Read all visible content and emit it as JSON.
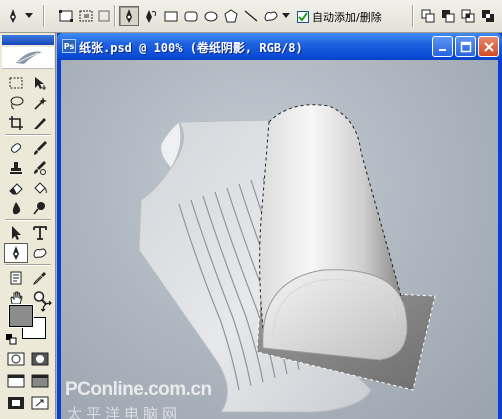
{
  "options_bar": {
    "auto_add_delete_label": "自动添加/删除",
    "auto_add_delete_checked": true
  },
  "toolbox": {
    "active_tool": "pen-tool",
    "foreground_color": "#8c8c8c",
    "background_color": "#ffffff"
  },
  "document": {
    "title": "纸张.psd @ 100% (卷纸阴影, RGB/8)"
  },
  "watermark": {
    "text": "PConline.com.cn",
    "cn_text": "太平洋电脑网"
  }
}
